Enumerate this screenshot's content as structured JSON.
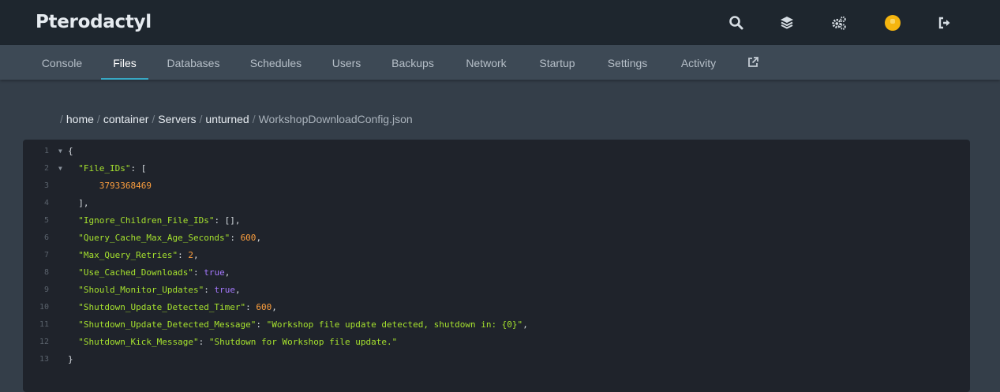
{
  "app": {
    "title": "Pterodactyl"
  },
  "topbar": {
    "icons": [
      "search-icon",
      "layers-icon",
      "cogs-icon",
      "avatar-icon",
      "sign-out-icon"
    ]
  },
  "nav": {
    "tabs": [
      {
        "label": "Console"
      },
      {
        "label": "Files",
        "active": true
      },
      {
        "label": "Databases"
      },
      {
        "label": "Schedules"
      },
      {
        "label": "Users"
      },
      {
        "label": "Backups"
      },
      {
        "label": "Network"
      },
      {
        "label": "Startup"
      },
      {
        "label": "Settings"
      },
      {
        "label": "Activity"
      }
    ],
    "external_icon": "external-link-icon"
  },
  "breadcrumb": {
    "sep": "/",
    "segments": [
      "home",
      "container",
      "Servers",
      "unturned"
    ],
    "current": "WorkshopDownloadConfig.json"
  },
  "editor": {
    "lines": [
      {
        "n": "1",
        "fold": true
      },
      {
        "n": "2",
        "fold": true
      },
      {
        "n": "3"
      },
      {
        "n": "4"
      },
      {
        "n": "5"
      },
      {
        "n": "6"
      },
      {
        "n": "7"
      },
      {
        "n": "8"
      },
      {
        "n": "9"
      },
      {
        "n": "10"
      },
      {
        "n": "11"
      },
      {
        "n": "12"
      },
      {
        "n": "13"
      }
    ],
    "tokens": {
      "l1": "{",
      "l2_key": "\"File_IDs\"",
      "l2_rest": ": [",
      "l3_val": "3793368469",
      "l4": "],",
      "l5_key": "\"Ignore_Children_File_IDs\"",
      "l5_rest": ": [],",
      "l6_key": "\"Query_Cache_Max_Age_Seconds\"",
      "l6_val": "600",
      "l7_key": "\"Max_Query_Retries\"",
      "l7_val": "2",
      "l8_key": "\"Use_Cached_Downloads\"",
      "l8_val": "true",
      "l9_key": "\"Should_Monitor_Updates\"",
      "l9_val": "true",
      "l10_key": "\"Shutdown_Update_Detected_Timer\"",
      "l10_val": "600",
      "l11_key": "\"Shutdown_Update_Detected_Message\"",
      "l11_val": "\"Workshop file update detected, shutdown in: {0}\"",
      "l12_key": "\"Shutdown_Kick_Message\"",
      "l12_val": "\"Shutdown for Workshop file update.\"",
      "l13": "}",
      "colon": ": ",
      "comma": ","
    }
  },
  "colors": {
    "topbar_bg": "#1e262e",
    "nav_bg": "#3d4955",
    "page_bg": "#343e49",
    "editor_bg": "#1f232b",
    "accent": "#38a8c4"
  }
}
